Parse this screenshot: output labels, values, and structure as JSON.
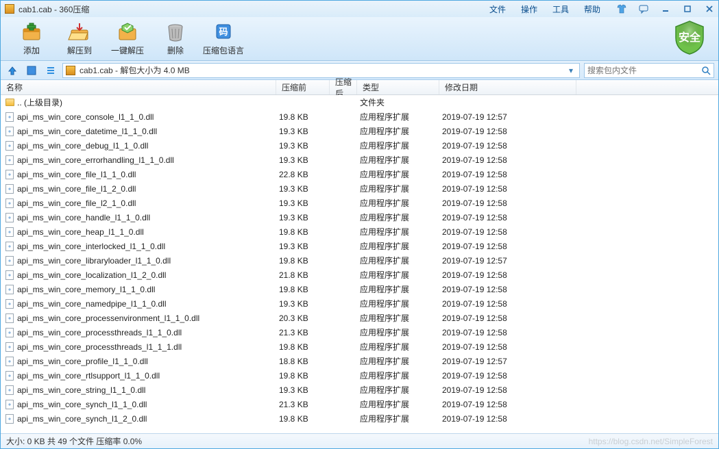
{
  "title": "cab1.cab - 360压缩",
  "menus": {
    "file": "文件",
    "operate": "操作",
    "tools": "工具",
    "help": "帮助"
  },
  "toolbar": {
    "add": "添加",
    "extract_to": "解压到",
    "one_click_extract": "一键解压",
    "delete": "删除",
    "archive_language": "压缩包语言",
    "safe_badge": "安全"
  },
  "path": "cab1.cab - 解包大小为 4.0 MB",
  "search_placeholder": "搜索包内文件",
  "columns": {
    "name": "名称",
    "before": "压缩前",
    "after": "压缩后",
    "type": "类型",
    "date": "修改日期"
  },
  "parent_row": {
    "name": ".. (上级目录)",
    "type": "文件夹"
  },
  "type_label": "应用程序扩展",
  "files": [
    {
      "name": "api_ms_win_core_console_l1_1_0.dll",
      "size": "19.8 KB",
      "date": "2019-07-19 12:57"
    },
    {
      "name": "api_ms_win_core_datetime_l1_1_0.dll",
      "size": "19.3 KB",
      "date": "2019-07-19 12:58"
    },
    {
      "name": "api_ms_win_core_debug_l1_1_0.dll",
      "size": "19.3 KB",
      "date": "2019-07-19 12:58"
    },
    {
      "name": "api_ms_win_core_errorhandling_l1_1_0.dll",
      "size": "19.3 KB",
      "date": "2019-07-19 12:58"
    },
    {
      "name": "api_ms_win_core_file_l1_1_0.dll",
      "size": "22.8 KB",
      "date": "2019-07-19 12:58"
    },
    {
      "name": "api_ms_win_core_file_l1_2_0.dll",
      "size": "19.3 KB",
      "date": "2019-07-19 12:58"
    },
    {
      "name": "api_ms_win_core_file_l2_1_0.dll",
      "size": "19.3 KB",
      "date": "2019-07-19 12:58"
    },
    {
      "name": "api_ms_win_core_handle_l1_1_0.dll",
      "size": "19.3 KB",
      "date": "2019-07-19 12:58"
    },
    {
      "name": "api_ms_win_core_heap_l1_1_0.dll",
      "size": "19.8 KB",
      "date": "2019-07-19 12:58"
    },
    {
      "name": "api_ms_win_core_interlocked_l1_1_0.dll",
      "size": "19.3 KB",
      "date": "2019-07-19 12:58"
    },
    {
      "name": "api_ms_win_core_libraryloader_l1_1_0.dll",
      "size": "19.8 KB",
      "date": "2019-07-19 12:57"
    },
    {
      "name": "api_ms_win_core_localization_l1_2_0.dll",
      "size": "21.8 KB",
      "date": "2019-07-19 12:58"
    },
    {
      "name": "api_ms_win_core_memory_l1_1_0.dll",
      "size": "19.8 KB",
      "date": "2019-07-19 12:58"
    },
    {
      "name": "api_ms_win_core_namedpipe_l1_1_0.dll",
      "size": "19.3 KB",
      "date": "2019-07-19 12:58"
    },
    {
      "name": "api_ms_win_core_processenvironment_l1_1_0.dll",
      "size": "20.3 KB",
      "date": "2019-07-19 12:58"
    },
    {
      "name": "api_ms_win_core_processthreads_l1_1_0.dll",
      "size": "21.3 KB",
      "date": "2019-07-19 12:58"
    },
    {
      "name": "api_ms_win_core_processthreads_l1_1_1.dll",
      "size": "19.8 KB",
      "date": "2019-07-19 12:58"
    },
    {
      "name": "api_ms_win_core_profile_l1_1_0.dll",
      "size": "18.8 KB",
      "date": "2019-07-19 12:57"
    },
    {
      "name": "api_ms_win_core_rtlsupport_l1_1_0.dll",
      "size": "19.8 KB",
      "date": "2019-07-19 12:58"
    },
    {
      "name": "api_ms_win_core_string_l1_1_0.dll",
      "size": "19.3 KB",
      "date": "2019-07-19 12:58"
    },
    {
      "name": "api_ms_win_core_synch_l1_1_0.dll",
      "size": "21.3 KB",
      "date": "2019-07-19 12:58"
    },
    {
      "name": "api_ms_win_core_synch_l1_2_0.dll",
      "size": "19.8 KB",
      "date": "2019-07-19 12:58"
    }
  ],
  "status": "大小: 0 KB 共 49 个文件 压缩率 0.0%",
  "watermark": "https://blog.csdn.net/SimpleForest"
}
